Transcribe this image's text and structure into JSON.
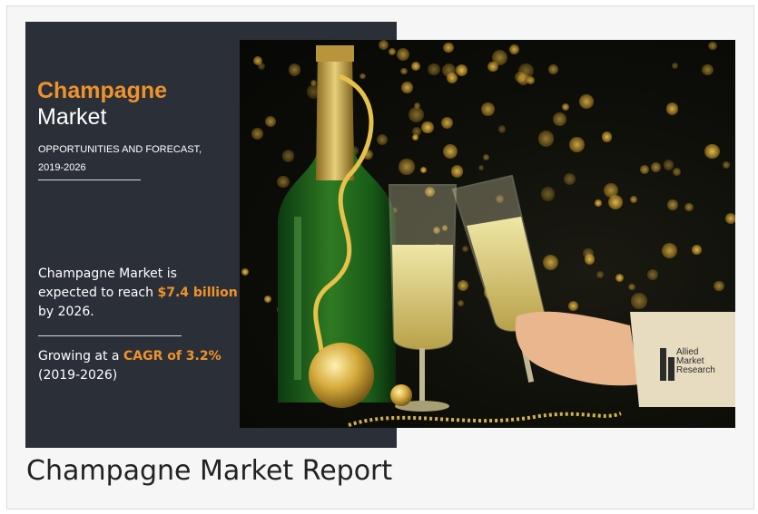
{
  "banner": {
    "title_highlight": "Champagne",
    "title_rest": "Market",
    "subtitle_line1": "OPPORTUNITIES AND FORECAST,",
    "subtitle_line2": "2019-2026",
    "expect_line1": "Champagne Market is",
    "expect_line2_prefix": "expected to reach ",
    "expect_value": "$7.4 billion",
    "expect_line3": "by 2026.",
    "growing_prefix": "Growing at a ",
    "growing_value": "CAGR of 3.2%",
    "growing_period": "(2019-2026)",
    "logo_line1": "Allied",
    "logo_line2": "Market",
    "logo_line3": "Research"
  },
  "caption": "Champagne Market Report",
  "colors": {
    "panel": "#2b3038",
    "accent": "#f0922b",
    "text": "#ffffff",
    "background": "#f6f6f6",
    "caption": "#222222"
  },
  "image": {
    "description_icon": "champagne-photo"
  }
}
